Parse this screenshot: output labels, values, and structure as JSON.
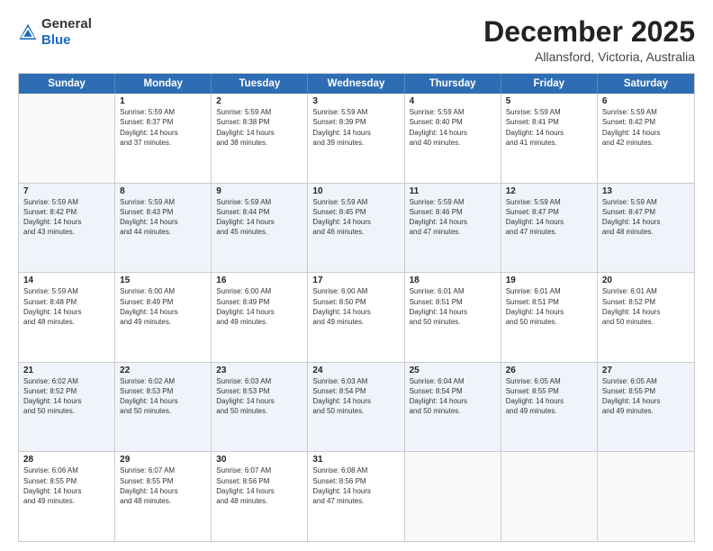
{
  "logo": {
    "general": "General",
    "blue": "Blue"
  },
  "header": {
    "month": "December 2025",
    "location": "Allansford, Victoria, Australia"
  },
  "weekdays": [
    "Sunday",
    "Monday",
    "Tuesday",
    "Wednesday",
    "Thursday",
    "Friday",
    "Saturday"
  ],
  "rows": [
    [
      {
        "day": "",
        "lines": [],
        "empty": true
      },
      {
        "day": "1",
        "lines": [
          "Sunrise: 5:59 AM",
          "Sunset: 8:37 PM",
          "Daylight: 14 hours",
          "and 37 minutes."
        ]
      },
      {
        "day": "2",
        "lines": [
          "Sunrise: 5:59 AM",
          "Sunset: 8:38 PM",
          "Daylight: 14 hours",
          "and 38 minutes."
        ]
      },
      {
        "day": "3",
        "lines": [
          "Sunrise: 5:59 AM",
          "Sunset: 8:39 PM",
          "Daylight: 14 hours",
          "and 39 minutes."
        ]
      },
      {
        "day": "4",
        "lines": [
          "Sunrise: 5:59 AM",
          "Sunset: 8:40 PM",
          "Daylight: 14 hours",
          "and 40 minutes."
        ]
      },
      {
        "day": "5",
        "lines": [
          "Sunrise: 5:59 AM",
          "Sunset: 8:41 PM",
          "Daylight: 14 hours",
          "and 41 minutes."
        ]
      },
      {
        "day": "6",
        "lines": [
          "Sunrise: 5:59 AM",
          "Sunset: 8:42 PM",
          "Daylight: 14 hours",
          "and 42 minutes."
        ]
      }
    ],
    [
      {
        "day": "7",
        "lines": [
          "Sunrise: 5:59 AM",
          "Sunset: 8:42 PM",
          "Daylight: 14 hours",
          "and 43 minutes."
        ]
      },
      {
        "day": "8",
        "lines": [
          "Sunrise: 5:59 AM",
          "Sunset: 8:43 PM",
          "Daylight: 14 hours",
          "and 44 minutes."
        ]
      },
      {
        "day": "9",
        "lines": [
          "Sunrise: 5:59 AM",
          "Sunset: 8:44 PM",
          "Daylight: 14 hours",
          "and 45 minutes."
        ]
      },
      {
        "day": "10",
        "lines": [
          "Sunrise: 5:59 AM",
          "Sunset: 8:45 PM",
          "Daylight: 14 hours",
          "and 46 minutes."
        ]
      },
      {
        "day": "11",
        "lines": [
          "Sunrise: 5:59 AM",
          "Sunset: 8:46 PM",
          "Daylight: 14 hours",
          "and 47 minutes."
        ]
      },
      {
        "day": "12",
        "lines": [
          "Sunrise: 5:59 AM",
          "Sunset: 8:47 PM",
          "Daylight: 14 hours",
          "and 47 minutes."
        ]
      },
      {
        "day": "13",
        "lines": [
          "Sunrise: 5:59 AM",
          "Sunset: 8:47 PM",
          "Daylight: 14 hours",
          "and 48 minutes."
        ]
      }
    ],
    [
      {
        "day": "14",
        "lines": [
          "Sunrise: 5:59 AM",
          "Sunset: 8:48 PM",
          "Daylight: 14 hours",
          "and 48 minutes."
        ]
      },
      {
        "day": "15",
        "lines": [
          "Sunrise: 6:00 AM",
          "Sunset: 8:49 PM",
          "Daylight: 14 hours",
          "and 49 minutes."
        ]
      },
      {
        "day": "16",
        "lines": [
          "Sunrise: 6:00 AM",
          "Sunset: 8:49 PM",
          "Daylight: 14 hours",
          "and 49 minutes."
        ]
      },
      {
        "day": "17",
        "lines": [
          "Sunrise: 6:00 AM",
          "Sunset: 8:50 PM",
          "Daylight: 14 hours",
          "and 49 minutes."
        ]
      },
      {
        "day": "18",
        "lines": [
          "Sunrise: 6:01 AM",
          "Sunset: 8:51 PM",
          "Daylight: 14 hours",
          "and 50 minutes."
        ]
      },
      {
        "day": "19",
        "lines": [
          "Sunrise: 6:01 AM",
          "Sunset: 8:51 PM",
          "Daylight: 14 hours",
          "and 50 minutes."
        ]
      },
      {
        "day": "20",
        "lines": [
          "Sunrise: 6:01 AM",
          "Sunset: 8:52 PM",
          "Daylight: 14 hours",
          "and 50 minutes."
        ]
      }
    ],
    [
      {
        "day": "21",
        "lines": [
          "Sunrise: 6:02 AM",
          "Sunset: 8:52 PM",
          "Daylight: 14 hours",
          "and 50 minutes."
        ]
      },
      {
        "day": "22",
        "lines": [
          "Sunrise: 6:02 AM",
          "Sunset: 8:53 PM",
          "Daylight: 14 hours",
          "and 50 minutes."
        ]
      },
      {
        "day": "23",
        "lines": [
          "Sunrise: 6:03 AM",
          "Sunset: 8:53 PM",
          "Daylight: 14 hours",
          "and 50 minutes."
        ]
      },
      {
        "day": "24",
        "lines": [
          "Sunrise: 6:03 AM",
          "Sunset: 8:54 PM",
          "Daylight: 14 hours",
          "and 50 minutes."
        ]
      },
      {
        "day": "25",
        "lines": [
          "Sunrise: 6:04 AM",
          "Sunset: 8:54 PM",
          "Daylight: 14 hours",
          "and 50 minutes."
        ]
      },
      {
        "day": "26",
        "lines": [
          "Sunrise: 6:05 AM",
          "Sunset: 8:55 PM",
          "Daylight: 14 hours",
          "and 49 minutes."
        ]
      },
      {
        "day": "27",
        "lines": [
          "Sunrise: 6:05 AM",
          "Sunset: 8:55 PM",
          "Daylight: 14 hours",
          "and 49 minutes."
        ]
      }
    ],
    [
      {
        "day": "28",
        "lines": [
          "Sunrise: 6:06 AM",
          "Sunset: 8:55 PM",
          "Daylight: 14 hours",
          "and 49 minutes."
        ]
      },
      {
        "day": "29",
        "lines": [
          "Sunrise: 6:07 AM",
          "Sunset: 8:55 PM",
          "Daylight: 14 hours",
          "and 48 minutes."
        ]
      },
      {
        "day": "30",
        "lines": [
          "Sunrise: 6:07 AM",
          "Sunset: 8:56 PM",
          "Daylight: 14 hours",
          "and 48 minutes."
        ]
      },
      {
        "day": "31",
        "lines": [
          "Sunrise: 6:08 AM",
          "Sunset: 8:56 PM",
          "Daylight: 14 hours",
          "and 47 minutes."
        ]
      },
      {
        "day": "",
        "lines": [],
        "empty": true
      },
      {
        "day": "",
        "lines": [],
        "empty": true
      },
      {
        "day": "",
        "lines": [],
        "empty": true
      }
    ]
  ]
}
